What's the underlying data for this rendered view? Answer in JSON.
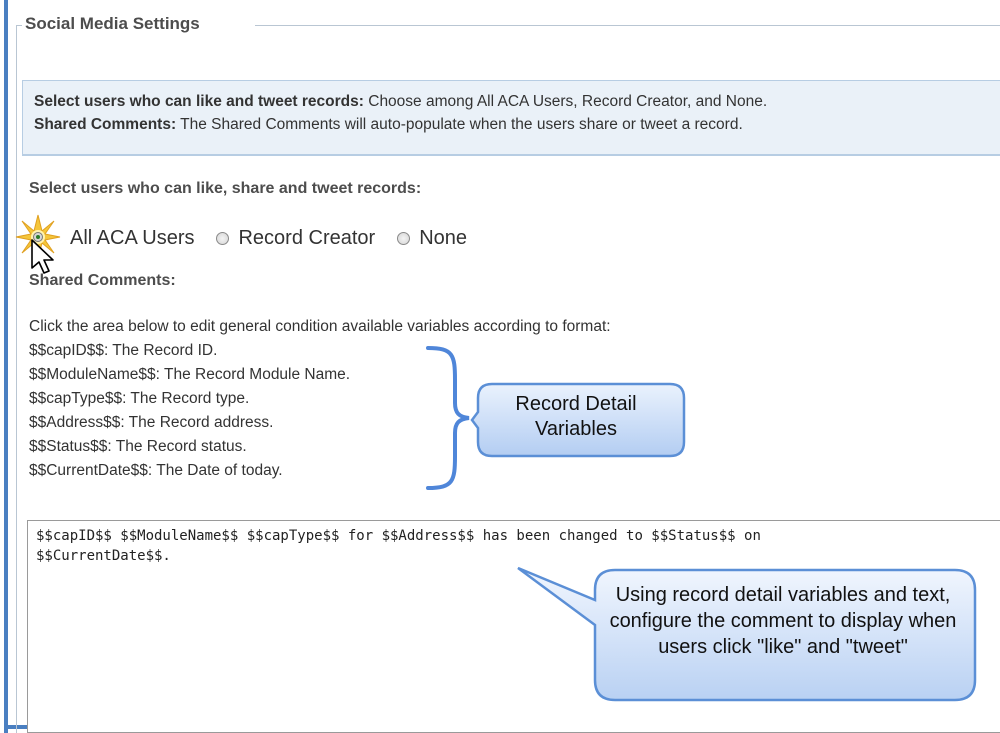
{
  "settings": {
    "legend": "Social Media Settings"
  },
  "info": {
    "line1_label": "Select users who can like and tweet records:",
    "line1_text": " Choose among All ACA Users, Record Creator, and None.",
    "line2_label": "Shared Comments:",
    "line2_text": " The Shared Comments will auto-populate when the users share or tweet a record."
  },
  "users_section": {
    "label": "Select users who can like, share and tweet records:",
    "options": [
      {
        "label": "All ACA Users",
        "selected": true
      },
      {
        "label": "Record Creator",
        "selected": false
      },
      {
        "label": "None",
        "selected": false
      }
    ]
  },
  "comments_section": {
    "label": "Shared Comments:",
    "instructions": "Click the area below to edit general condition available variables according to format:",
    "variables": [
      "$$capID$$: The Record ID.",
      "$$ModuleName$$: The Record Module Name.",
      "$$capType$$: The Record type.",
      "$$Address$$: The Record address.",
      "$$Status$$: The Record status.",
      "$$CurrentDate$$: The Date of today."
    ],
    "textarea_value": "$$capID$$ $$ModuleName$$ $$capType$$ for $$Address$$ has been changed to $$Status$$ on\n$$CurrentDate$$."
  },
  "callouts": {
    "record_detail": "Record Detail Variables",
    "usage": "Using record detail variables and text, configure the comment to display when users click \"like\" and \"tweet\""
  },
  "colors": {
    "frame": "#4a7fc1",
    "info_bg": "#eaf1f8",
    "callout_fill": "#c9dcf7",
    "callout_stroke": "#5b8fd6"
  }
}
